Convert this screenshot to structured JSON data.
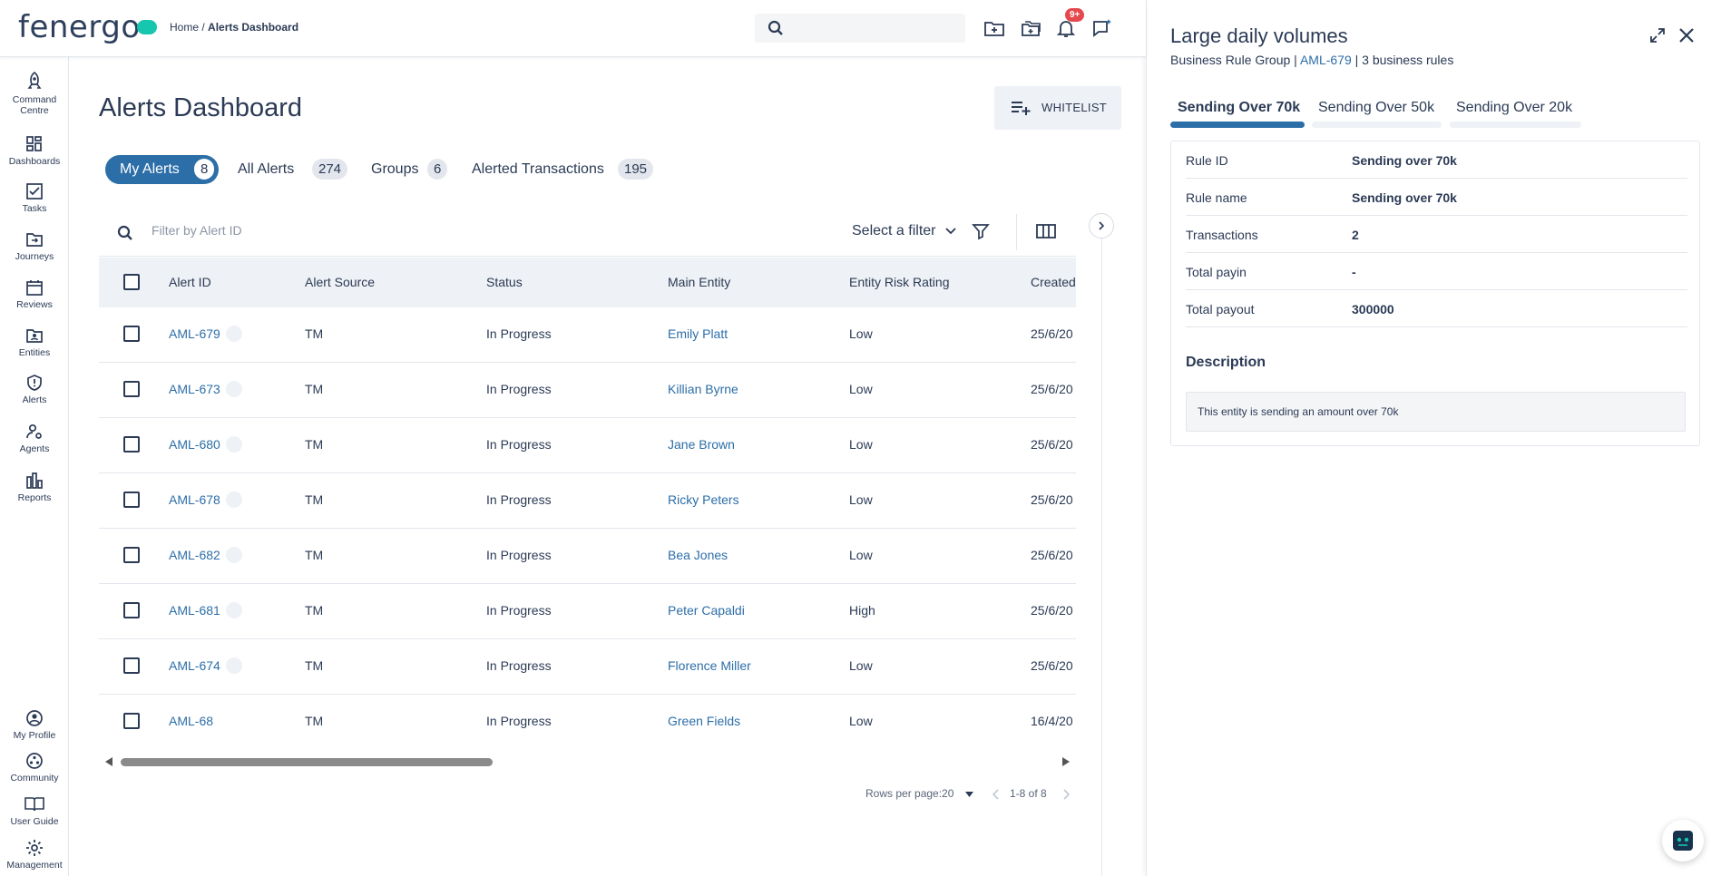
{
  "header": {
    "logo": "fenergo",
    "breadcrumb": {
      "home": "Home",
      "sep": " / ",
      "current": "Alerts Dashboard"
    },
    "notifications_badge": "9+"
  },
  "nav": {
    "items": [
      {
        "label": "Command Centre",
        "icon": "rocket-icon"
      },
      {
        "label": "Dashboards",
        "icon": "dashboard-grid-icon"
      },
      {
        "label": "Tasks",
        "icon": "checkbox-icon"
      },
      {
        "label": "Journeys",
        "icon": "journey-icon"
      },
      {
        "label": "Reviews",
        "icon": "calendar-icon"
      },
      {
        "label": "Entities",
        "icon": "folder-person-icon"
      },
      {
        "label": "Alerts",
        "icon": "shield-alert-icon"
      },
      {
        "label": "Agents",
        "icon": "agent-gear-icon"
      },
      {
        "label": "Reports",
        "icon": "bar-chart-icon"
      }
    ],
    "bottom": [
      {
        "label": "My Profile",
        "icon": "profile-icon"
      },
      {
        "label": "Community",
        "icon": "community-icon"
      },
      {
        "label": "User Guide",
        "icon": "book-icon"
      },
      {
        "label": "Management",
        "icon": "gear-icon"
      }
    ]
  },
  "main": {
    "title": "Alerts Dashboard",
    "whitelist_label": "WHITELIST",
    "tabs": [
      {
        "label": "My Alerts",
        "count": "8"
      },
      {
        "label": "All Alerts",
        "count": "274"
      },
      {
        "label": "Groups",
        "count": "6"
      },
      {
        "label": "Alerted Transactions",
        "count": "195"
      }
    ],
    "filter_placeholder": "Filter by Alert ID",
    "select_filter": "Select a filter",
    "columns": [
      "Alert ID",
      "Alert Source",
      "Status",
      "Main Entity",
      "Entity Risk Rating",
      "Created"
    ],
    "rows": [
      {
        "id": "AML-679",
        "source": "TM",
        "status": "In Progress",
        "entity": "Emily Platt",
        "risk": "Low",
        "created": "25/6/20"
      },
      {
        "id": "AML-673",
        "source": "TM",
        "status": "In Progress",
        "entity": "Killian Byrne",
        "risk": "Low",
        "created": "25/6/20"
      },
      {
        "id": "AML-680",
        "source": "TM",
        "status": "In Progress",
        "entity": "Jane Brown",
        "risk": "Low",
        "created": "25/6/20"
      },
      {
        "id": "AML-678",
        "source": "TM",
        "status": "In Progress",
        "entity": "Ricky Peters",
        "risk": "Low",
        "created": "25/6/20"
      },
      {
        "id": "AML-682",
        "source": "TM",
        "status": "In Progress",
        "entity": "Bea Jones",
        "risk": "Low",
        "created": "25/6/20"
      },
      {
        "id": "AML-681",
        "source": "TM",
        "status": "In Progress",
        "entity": "Peter Capaldi",
        "risk": "High",
        "created": "25/6/20"
      },
      {
        "id": "AML-674",
        "source": "TM",
        "status": "In Progress",
        "entity": "Florence Miller",
        "risk": "Low",
        "created": "25/6/20"
      },
      {
        "id": "AML-68",
        "source": "TM",
        "status": "In Progress",
        "entity": "Green Fields",
        "risk": "Low",
        "created": "16/4/20"
      }
    ],
    "pager": {
      "rows_per_page": "Rows per page:20",
      "range": "1-8 of 8"
    }
  },
  "panel": {
    "title": "Large daily volumes",
    "sub_prefix": "Business Rule Group | ",
    "sub_link": "AML-679",
    "sub_suffix": " | 3 business rules",
    "tabs": [
      "Sending Over 70k",
      "Sending Over 50k",
      "Sending Over 20k"
    ],
    "fields": [
      {
        "k": "Rule ID",
        "v": "Sending over 70k"
      },
      {
        "k": "Rule name",
        "v": "Sending over 70k"
      },
      {
        "k": "Transactions",
        "v": "2"
      },
      {
        "k": "Total payin",
        "v": "-"
      },
      {
        "k": "Total payout",
        "v": "300000"
      }
    ],
    "description_title": "Description",
    "description": "This entity is sending an amount over 70k"
  },
  "colors": {
    "accent": "#2c6ea8",
    "brand": "#17c6ae",
    "text": "#2b3a55",
    "alert": "#e5484d"
  }
}
